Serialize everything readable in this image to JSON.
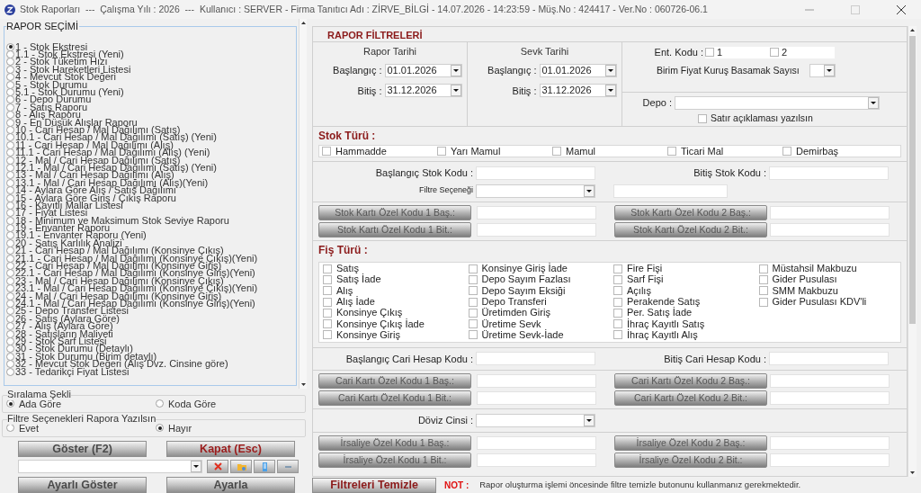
{
  "window": {
    "title": "Stok Raporları  ---  Çalışma Yılı : 2026  ---  Kullanıcı : SERVER - Firma Tanıtıcı Adı : ZİRVE_BİLGİ - 14.07.2026 - 14:23:59 - Müş.No : 424417 - Ver.No : 060726-06.1"
  },
  "report_list": {
    "title": "RAPOR SEÇİMİ",
    "items": [
      {
        "label": "1 - Stok Ekstresi",
        "selected": true
      },
      {
        "label": "1.1 - Stok Ekstresi (Yeni)",
        "selected": false
      },
      {
        "label": "2 - Stok Tüketim Hızı",
        "selected": false
      },
      {
        "label": "3 - Stok Hareketleri Listesi",
        "selected": false
      },
      {
        "label": "4 - Mevcut Stok Değeri",
        "selected": false
      },
      {
        "label": "5 - Stok Durumu",
        "selected": false
      },
      {
        "label": "5.1 - Stok Durumu (Yeni)",
        "selected": false
      },
      {
        "label": "6 - Depo Durumu",
        "selected": false
      },
      {
        "label": "7 - Satış Raporu",
        "selected": false
      },
      {
        "label": "8 - Alış Raporu",
        "selected": false
      },
      {
        "label": "9 - En Düşük Alışlar Raporu",
        "selected": false
      },
      {
        "label": "10 - Cari Hesap / Mal Dağılımı (Satış)",
        "selected": false
      },
      {
        "label": "10.1 - Cari Hesap / Mal Dağılımı (Satış) (Yeni)",
        "selected": false
      },
      {
        "label": "11 - Cari Hesap / Mal Dağılımı (Alış)",
        "selected": false
      },
      {
        "label": "11.1 - Cari Hesap / Mal Dağılımı (Alış) (Yeni)",
        "selected": false
      },
      {
        "label": "12 - Mal / Cari Hesap Dağılımı (Satış)",
        "selected": false
      },
      {
        "label": "12.1 - Mal / Cari Hesap Dağılımı (Satış) (Yeni)",
        "selected": false
      },
      {
        "label": "13 - Mal / Cari Hesap Dağılımı (Alış)",
        "selected": false
      },
      {
        "label": "13.1 - Mal / Cari Hesap Dağılımı (Alış)(Yeni)",
        "selected": false
      },
      {
        "label": "14 - Aylara Göre Alış / Satış Dağılımı",
        "selected": false
      },
      {
        "label": "15 - Aylara Göre Giriş / Çıkış Raporu",
        "selected": false
      },
      {
        "label": "16 - Kayıtlı Mallar Listesi",
        "selected": false
      },
      {
        "label": "17 - Fiyat Listesi",
        "selected": false
      },
      {
        "label": "18 - Minimum ve Maksimum Stok Seviye Raporu",
        "selected": false
      },
      {
        "label": "19 - Envanter Raporu",
        "selected": false
      },
      {
        "label": "19.1 - Envanter Raporu (Yeni)",
        "selected": false
      },
      {
        "label": "20 - Satış Karlılık Analizi",
        "selected": false
      },
      {
        "label": "21 - Cari Hesap / Mal Dağılımı (Konsinye Çıkış)",
        "selected": false
      },
      {
        "label": "21.1 - Cari Hesap / Mal Dağılımı (Konsinye Çıkış)(Yeni)",
        "selected": false
      },
      {
        "label": "22 - Cari Hesap / Mal Dağılımı (Konsinye Giriş)",
        "selected": false
      },
      {
        "label": "22.1 - Cari Hesap / Mal Dağılımı (Konsinye Giriş)(Yeni)",
        "selected": false
      },
      {
        "label": "23 - Mal / Cari Hesap Dağılımı (Konsinye Çıkış)",
        "selected": false
      },
      {
        "label": "23.1 - Mal / Cari Hesap Dağılımı (Konsinye Çıkış)(Yeni)",
        "selected": false
      },
      {
        "label": "24 - Mal / Cari Hesap Dağılımı (Konsinye Giriş)",
        "selected": false
      },
      {
        "label": "24.1 - Mal / Cari Hesap Dağılımı (Konsinye Giriş)(Yeni)",
        "selected": false
      },
      {
        "label": "25 - Depo Transfer Listesi",
        "selected": false
      },
      {
        "label": "26 - Satış (Aylara Göre)",
        "selected": false
      },
      {
        "label": "27 - Alış (Aylara Göre)",
        "selected": false
      },
      {
        "label": "28 - Satışların Maliyeti",
        "selected": false
      },
      {
        "label": "29 - Stok Sarf Listesi",
        "selected": false
      },
      {
        "label": "30 - Stok Durumu (Detaylı)",
        "selected": false
      },
      {
        "label": "31 - Stok Durumu (Birim detaylı)",
        "selected": false
      },
      {
        "label": "32 - Mevcut Stok Değeri (Alış Dvz. Cinsine göre)",
        "selected": false
      },
      {
        "label": "33 - Tedarikçi Fiyat Listesi",
        "selected": false
      }
    ]
  },
  "sort": {
    "title": "Sıralama Şekli",
    "options": [
      {
        "label": "Ada Göre",
        "selected": true
      },
      {
        "label": "Koda Göre",
        "selected": false
      }
    ]
  },
  "print_filters": {
    "title": "Filtre Seçenekleri Rapora Yazılsın",
    "options": [
      {
        "label": "Evet",
        "selected": false
      },
      {
        "label": "Hayır",
        "selected": true
      }
    ]
  },
  "actions": [
    {
      "label": "Göster (F2)",
      "kind": "plain"
    },
    {
      "label": "Kapat (Esc)",
      "kind": "danger"
    }
  ],
  "settings_actions": [
    {
      "label": "Ayarlı Göster"
    },
    {
      "label": "Ayarla"
    }
  ],
  "filters": {
    "title": "RAPOR FİLTRELERİ",
    "date_groups": [
      {
        "title": "Rapor Tarihi",
        "start_label": "Başlangıç :",
        "start": "01.01.2026",
        "end_label": "Bitiş :",
        "end": "31.12.2026"
      },
      {
        "title": "Sevk Tarihi",
        "start_label": "Başlangıç :",
        "start": "01.01.2026",
        "end_label": "Bitiş :",
        "end": "31.12.2026"
      }
    ],
    "ent_kodu": {
      "label": "Ent. Kodu :",
      "options": [
        {
          "label": "1",
          "checked": false
        },
        {
          "label": "2",
          "checked": false
        }
      ]
    },
    "price_digits_label": "Birim Fiyat Kuruş Basamak Sayısı",
    "depo_label": "Depo :",
    "line_description": {
      "label": "Satır açıklaması yazılsın",
      "checked": false
    },
    "stock_type": {
      "title": "Stok Türü :",
      "options": [
        {
          "label": "Hammadde",
          "checked": false
        },
        {
          "label": "Yarı Mamul",
          "checked": false
        },
        {
          "label": "Mamul",
          "checked": false
        },
        {
          "label": "Ticari Mal",
          "checked": false
        },
        {
          "label": "Demirbaş",
          "checked": false
        }
      ]
    },
    "stock_code": {
      "start_label": "Başlangıç Stok Kodu :",
      "end_label": "Bitiş Stok Kodu :",
      "filter_label": "Filtre Seçeneği"
    },
    "stock_card_codes": [
      "Stok Kartı Özel Kodu 1 Baş.:",
      "Stok Kartı Özel Kodu 2 Baş.:",
      "Stok Kartı Özel Kodu 1 Bit.:",
      "Stok Kartı Özel Kodu 2 Bit.:"
    ],
    "slip_type": {
      "title": "Fiş Türü :",
      "options": [
        {
          "label": "Satış",
          "checked": false
        },
        {
          "label": "Satış İade",
          "checked": false
        },
        {
          "label": "Alış",
          "checked": false
        },
        {
          "label": "Alış İade",
          "checked": false
        },
        {
          "label": "Konsinye Çıkış",
          "checked": false
        },
        {
          "label": "Konsinye Çıkış İade",
          "checked": false
        },
        {
          "label": "Konsinye Giriş",
          "checked": false
        },
        {
          "label": "Konsinye Giriş İade",
          "checked": false
        },
        {
          "label": "Depo Sayım Fazlası",
          "checked": false
        },
        {
          "label": "Depo Sayım Eksiği",
          "checked": false
        },
        {
          "label": "Depo Transferi",
          "checked": false
        },
        {
          "label": "Üretimden Giriş",
          "checked": false
        },
        {
          "label": "Üretime Sevk",
          "checked": false
        },
        {
          "label": "Üretime Sevk-İade",
          "checked": false
        },
        {
          "label": "Fire Fişi",
          "checked": false
        },
        {
          "label": "Sarf Fişi",
          "checked": false
        },
        {
          "label": "Açılış",
          "checked": false
        },
        {
          "label": "Perakende Satış",
          "checked": false
        },
        {
          "label": "Per. Satış İade",
          "checked": false
        },
        {
          "label": "İhraç Kayıtlı Satış",
          "checked": false
        },
        {
          "label": "İhraç Kayıtlı Alış",
          "checked": false
        },
        {
          "label": "Müstahsil Makbuzu",
          "checked": false
        },
        {
          "label": "Gider Pusulası",
          "checked": false
        },
        {
          "label": "SMM Makbuzu",
          "checked": false
        },
        {
          "label": "Gider Pusulası KDV'li",
          "checked": false
        }
      ]
    },
    "account_code": {
      "start_label": "Başlangıç Cari Hesap Kodu :",
      "end_label": "Bitiş Cari Hesap Kodu :"
    },
    "account_card_codes": [
      "Cari Kartı Özel Kodu 1 Baş.:",
      "Cari Kartı Özel Kodu 2 Baş.:",
      "Cari Kartı Özel Kodu 1 Bit.:",
      "Cari Kartı Özel Kodu 2 Bit.:"
    ],
    "currency_label": "Döviz Cinsi :",
    "waybill_codes": [
      "İrsaliye Özel Kodu 1 Baş.:",
      "İrsaliye Özel Kodu 2 Baş.:",
      "İrsaliye Özel Kodu 1 Bit.:",
      "İrsaliye Özel Kodu 2 Bit.:"
    ]
  },
  "footer": {
    "button": "Filtreleri Temizle",
    "note_label": "NOT :",
    "note": "Rapor oluşturma işlemi öncesinde filtre temizle butonunu kullanmanız gerekmektedir."
  }
}
